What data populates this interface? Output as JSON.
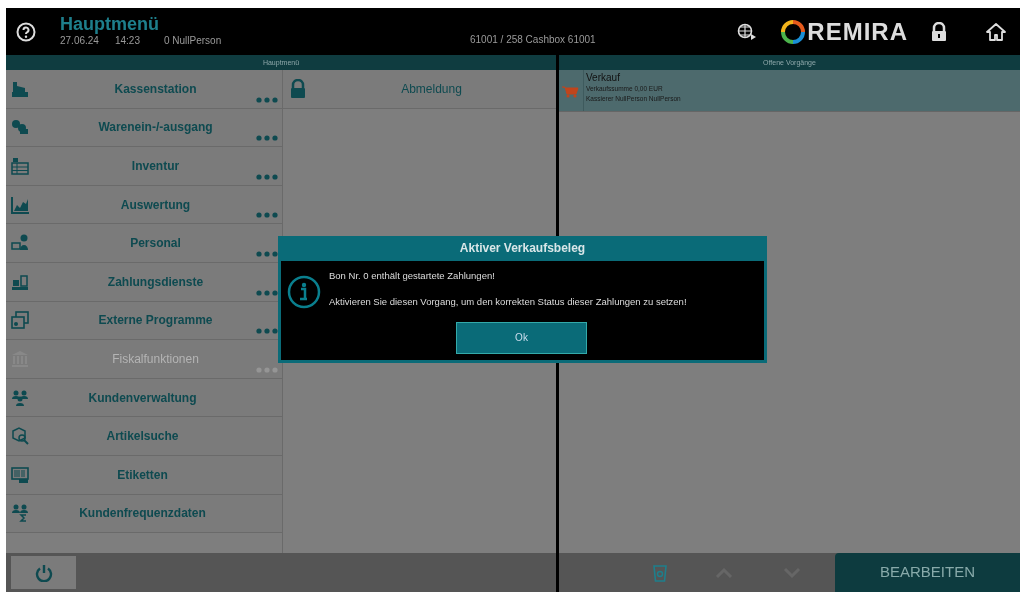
{
  "header": {
    "title": "Hauptmenü",
    "date": "27.06.24",
    "time": "14:23",
    "user": "0 NullPerson",
    "register": "61001 / 258 Cashbox 61001",
    "logo": "REMIRA"
  },
  "main_menu": {
    "title": "Hauptmenü",
    "items": [
      {
        "label": "Kassenstation",
        "disabled": false,
        "more": true
      },
      {
        "label": "Warenein-/-ausgang",
        "disabled": false,
        "more": true
      },
      {
        "label": "Inventur",
        "disabled": false,
        "more": true
      },
      {
        "label": "Auswertung",
        "disabled": false,
        "more": true
      },
      {
        "label": "Personal",
        "disabled": false,
        "more": true
      },
      {
        "label": "Zahlungsdienste",
        "disabled": false,
        "more": true
      },
      {
        "label": "Externe Programme",
        "disabled": false,
        "more": true
      },
      {
        "label": "Fiskalfunktionen",
        "disabled": true,
        "more": true
      },
      {
        "label": "Kundenverwaltung",
        "disabled": false,
        "more": false
      },
      {
        "label": "Artikelsuche",
        "disabled": false,
        "more": false
      },
      {
        "label": "Etiketten",
        "disabled": false,
        "more": false
      },
      {
        "label": "Kundenfrequenzdaten",
        "disabled": false,
        "more": false
      }
    ]
  },
  "sub_menu": {
    "items": [
      {
        "label": "Abmeldung"
      }
    ]
  },
  "open_transactions": {
    "title": "Offene Vorgänge",
    "items": [
      {
        "title": "Verkauf",
        "lines": [
          "Verkaufssumme 0,00 EUR",
          "Kassierer NullPerson NullPerson"
        ],
        "selected": true
      }
    ]
  },
  "footer": {
    "edit_button": "BEARBEITEN"
  },
  "dialog": {
    "title": "Aktiver Verkaufsbeleg",
    "messages": [
      "Bon Nr. 0 enthält gestartete Zahlungen!",
      "Aktivieren Sie diesen Vorgang, um den korrekten Status dieser Zahlungen zu setzen!"
    ],
    "button": "Ok"
  }
}
